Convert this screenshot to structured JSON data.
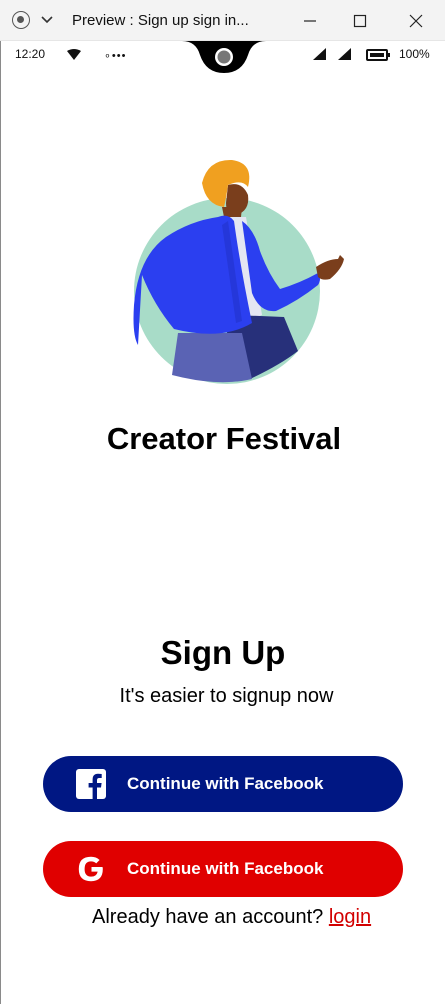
{
  "window": {
    "title": "Preview : Sign up sign in..."
  },
  "status_bar": {
    "time": "12:20",
    "dots": "∘•••",
    "battery_percent": "100%"
  },
  "app": {
    "title": "Creator Festival"
  },
  "signup": {
    "title": "Sign Up",
    "subtitle": "It's easier to signup now"
  },
  "buttons": {
    "facebook_label": "Continue with Facebook",
    "google_label": "Continue with Facebook"
  },
  "login": {
    "prompt": "Already have an account?",
    "link_label": "login"
  },
  "colors": {
    "facebook_button": "#001783",
    "google_button": "#e00000",
    "login_link": "#d20000",
    "illustration_circle": "#a8dcc8",
    "jacket": "#2b3ff0",
    "turban": "#f0a020"
  }
}
